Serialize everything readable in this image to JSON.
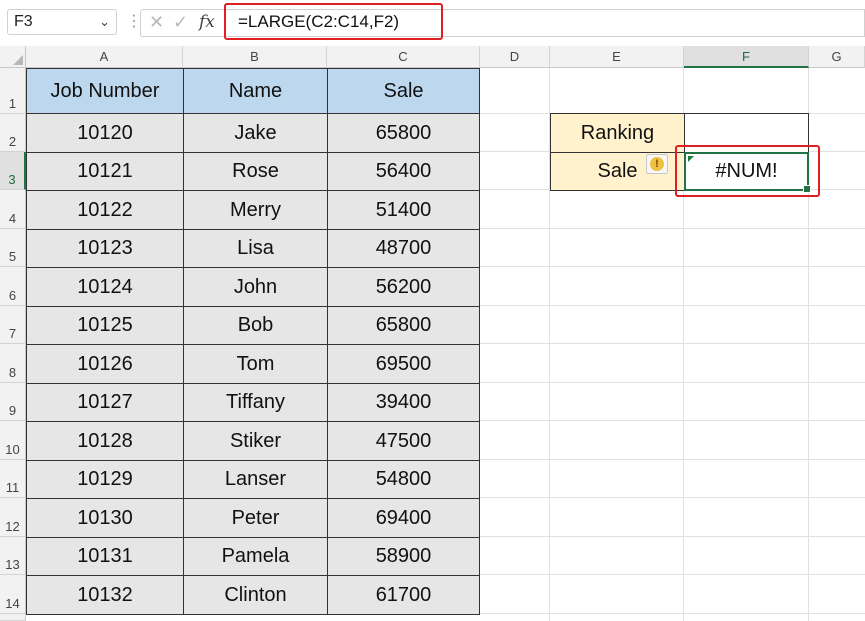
{
  "formula_bar": {
    "name_box": "F3",
    "name_box_chevron": "chevron-down-icon",
    "cancel_icon": "✕",
    "enter_icon": "✓",
    "fx_icon": "fx",
    "formula": "=LARGE(C2:C14,F2)"
  },
  "columns": [
    "A",
    "B",
    "C",
    "D",
    "E",
    "F",
    "G"
  ],
  "rows": [
    "1",
    "2",
    "3",
    "4",
    "5",
    "6",
    "7",
    "8",
    "9",
    "10",
    "11",
    "12",
    "13",
    "14"
  ],
  "table": {
    "headers": [
      "Job Number",
      "Name",
      "Sale"
    ],
    "rows": [
      [
        "10120",
        "Jake",
        "65800"
      ],
      [
        "10121",
        "Rose",
        "56400"
      ],
      [
        "10122",
        "Merry",
        "51400"
      ],
      [
        "10123",
        "Lisa",
        "48700"
      ],
      [
        "10124",
        "John",
        "56200"
      ],
      [
        "10125",
        "Bob",
        "65800"
      ],
      [
        "10126",
        "Tom",
        "69500"
      ],
      [
        "10127",
        "Tiffany",
        "39400"
      ],
      [
        "10128",
        "Stiker",
        "47500"
      ],
      [
        "10129",
        "Lanser",
        "54800"
      ],
      [
        "10130",
        "Peter",
        "69400"
      ],
      [
        "10131",
        "Pamela",
        "58900"
      ],
      [
        "10132",
        "Clinton",
        "61700"
      ]
    ]
  },
  "lookup": {
    "ranking_label": "Ranking",
    "ranking_value": "",
    "sale_label": "Sale",
    "sale_value": "#NUM!",
    "warning_icon": "!"
  },
  "colors": {
    "header_fill": "#bdd7ee",
    "data_fill": "#e7e6e6",
    "label_fill": "#fff2cc",
    "highlight": "#e02020",
    "selection": "#217346"
  }
}
